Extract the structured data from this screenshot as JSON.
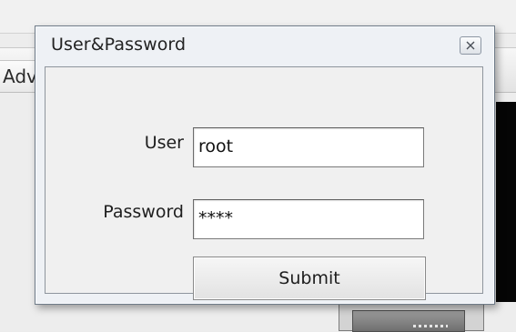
{
  "window": {
    "title": "User&Password"
  },
  "background": {
    "tab_label": "Adv"
  },
  "form": {
    "user_label": "User",
    "user_value": "root",
    "password_label": "Password",
    "password_value": "****",
    "submit_label": "Submit"
  },
  "icons": {
    "close": "close-icon"
  }
}
